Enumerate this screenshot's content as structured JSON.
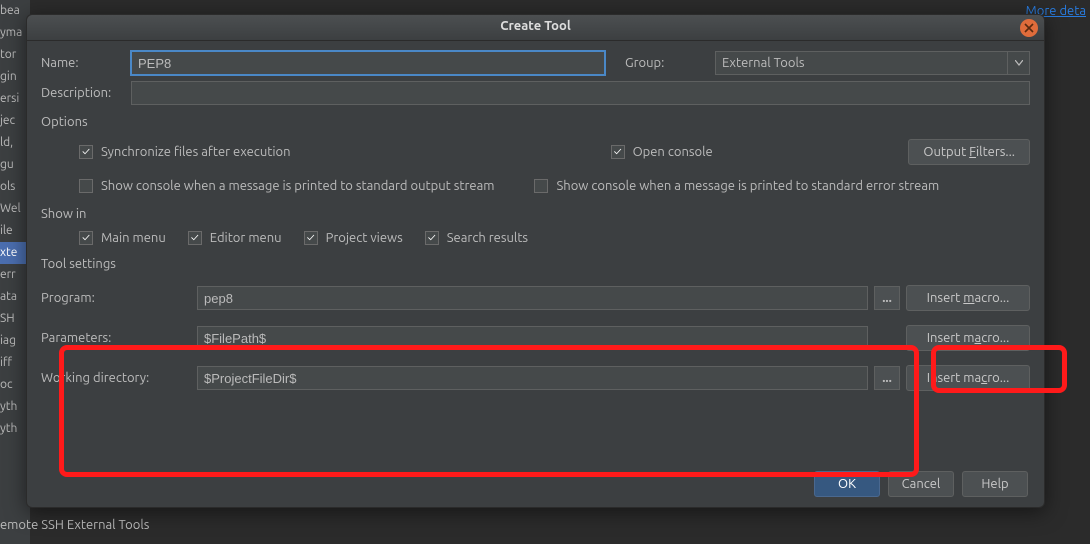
{
  "bg": {
    "sidebar_items": [
      "bea",
      "yma",
      "tor",
      "gin",
      "ersi",
      "jec",
      "ld,",
      "gu",
      "ols",
      "Wel",
      "ile",
      "xte",
      "err",
      "ata",
      "SH",
      "iag",
      "iff",
      "oc",
      "yth",
      "yth"
    ],
    "selected_index": 11,
    "bottom_label": "emote SSH External Tools",
    "more_link": "More deta"
  },
  "dialog": {
    "title": "Create Tool",
    "name_label": "Name:",
    "name_value": "PEP8",
    "group_label": "Group:",
    "group_value": "External Tools",
    "description_label": "Description:",
    "description_value": "",
    "options_header": "Options",
    "opt_sync": "Synchronize files after execution",
    "opt_sync_checked": true,
    "opt_open_console": "Open console",
    "opt_open_console_checked": true,
    "output_filters_btn": "Output Filters...",
    "opt_show_out": "Show console when a message is printed to standard output stream",
    "opt_show_out_checked": false,
    "opt_show_err": "Show console when a message is printed to standard error stream",
    "opt_show_err_checked": false,
    "showin_header": "Show in",
    "show_main": "Main menu",
    "show_editor": "Editor menu",
    "show_project": "Project views",
    "show_search": "Search results",
    "tool_settings_header": "Tool settings",
    "program_label": "Program:",
    "program_value": "pep8",
    "parameters_label": "Parameters:",
    "parameters_value": "$FilePath$",
    "workdir_label": "Working directory:",
    "workdir_value": "$ProjectFileDir$",
    "macro_btn": "Insert macro...",
    "browse_label": "...",
    "ok": "OK",
    "cancel": "Cancel",
    "help": "Help"
  }
}
